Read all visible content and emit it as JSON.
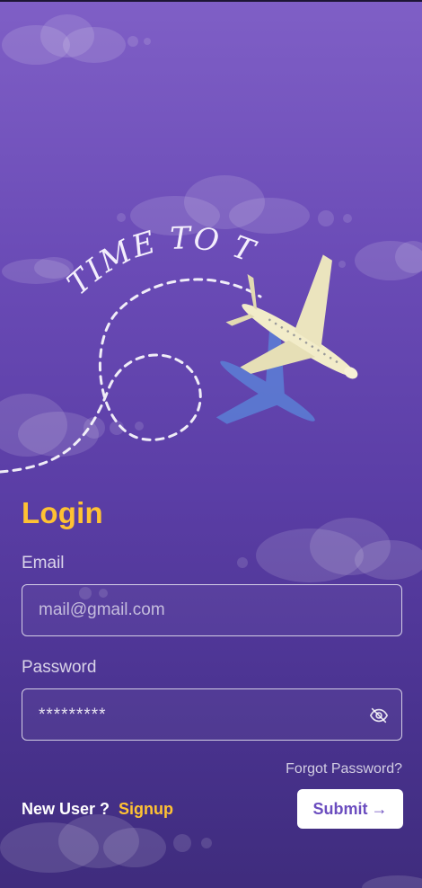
{
  "hero": {
    "tagline": "TIME TO TRAVEL"
  },
  "login": {
    "title": "Login",
    "email": {
      "label": "Email",
      "placeholder": "mail@gmail.com"
    },
    "password": {
      "label": "Password",
      "masked_value": "*********",
      "toggle_icon": "eye-off-icon"
    },
    "forgot_password": "Forgot Password?",
    "new_user_text": "New User ?",
    "signup_link": "Signup",
    "submit_label": "Submit",
    "submit_icon": "arrow-right-icon"
  },
  "colors": {
    "accent": "#ffc233",
    "button_text": "#6b4dbf",
    "bg_top": "#7f5fc6",
    "bg_bottom": "#3f2c7d"
  }
}
